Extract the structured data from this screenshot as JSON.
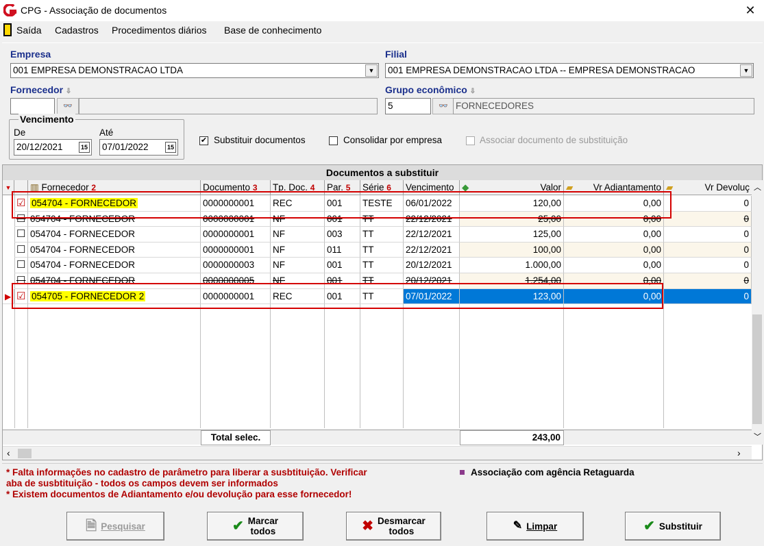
{
  "window": {
    "title": "CPG - Associação de documentos",
    "close_glyph": "✕"
  },
  "menu": {
    "items": [
      "Saída",
      "Cadastros",
      "Procedimentos diários",
      "Base de conhecimento"
    ]
  },
  "form": {
    "empresa_label": "Empresa",
    "empresa_value": "001 EMPRESA DEMONSTRACAO LTDA",
    "filial_label": "Filial",
    "filial_value": "001 EMPRESA DEMONSTRACAO LTDA -- EMPRESA DEMONSTRACAO",
    "fornecedor_label": "Fornecedor",
    "fornecedor_value": "",
    "fornecedor_name": "",
    "grupo_label": "Grupo econômico",
    "grupo_value": "5",
    "grupo_name": "FORNECEDORES",
    "vencimento_label": "Vencimento",
    "de_label": "De",
    "de_value": "20/12/2021",
    "ate_label": "Até",
    "ate_value": "07/01/2022",
    "date_btn": "15",
    "chk_substituir": "Substituir documentos",
    "chk_consolidar": "Consolidar por empresa",
    "chk_associar": "Associar documento de substituição"
  },
  "grid": {
    "caption": "Documentos a substituir",
    "headers": [
      {
        "label": "Fornecedor",
        "num": "2"
      },
      {
        "label": "Documento",
        "num": "3"
      },
      {
        "label": "Tp. Doc.",
        "num": "4"
      },
      {
        "label": "Par.",
        "num": "5"
      },
      {
        "label": "Série",
        "num": "6"
      },
      {
        "label": "Vencimento",
        "num": ""
      },
      {
        "label": "Valor",
        "num": ""
      },
      {
        "label": "Vr Adiantamento",
        "num": ""
      },
      {
        "label": "Vr Devoluç",
        "num": ""
      }
    ],
    "rows": [
      {
        "checked": "☑",
        "fornecedor": "054704 - FORNECEDOR",
        "documento": "0000000001",
        "tp": "REC",
        "par": "001",
        "serie": "TESTE",
        "venc": "06/01/2022",
        "valor": "120,00",
        "adiant": "0,00",
        "devol": "0"
      },
      {
        "checked": "☐",
        "fornecedor": "054704 - FORNECEDOR",
        "documento": "0000000001",
        "tp": "NF",
        "par": "001",
        "serie": "TT",
        "venc": "22/12/2021",
        "valor": "25,00",
        "adiant": "0,00",
        "devol": "0"
      },
      {
        "checked": "☐",
        "fornecedor": "054704 - FORNECEDOR",
        "documento": "0000000001",
        "tp": "NF",
        "par": "003",
        "serie": "TT",
        "venc": "22/12/2021",
        "valor": "125,00",
        "adiant": "0,00",
        "devol": "0"
      },
      {
        "checked": "☐",
        "fornecedor": "054704 - FORNECEDOR",
        "documento": "0000000001",
        "tp": "NF",
        "par": "011",
        "serie": "TT",
        "venc": "22/12/2021",
        "valor": "100,00",
        "adiant": "0,00",
        "devol": "0"
      },
      {
        "checked": "☐",
        "fornecedor": "054704 - FORNECEDOR",
        "documento": "0000000003",
        "tp": "NF",
        "par": "001",
        "serie": "TT",
        "venc": "20/12/2021",
        "valor": "1.000,00",
        "adiant": "0,00",
        "devol": "0"
      },
      {
        "checked": "☐",
        "fornecedor": "054704 - FORNECEDOR",
        "documento": "0000000005",
        "tp": "NF",
        "par": "001",
        "serie": "TT",
        "venc": "20/12/2021",
        "valor": "1.254,00",
        "adiant": "0,00",
        "devol": "0"
      },
      {
        "checked": "☑",
        "fornecedor": "054705 - FORNECEDOR 2",
        "documento": "0000000001",
        "tp": "REC",
        "par": "001",
        "serie": "TT",
        "venc": "07/01/2022",
        "valor": "123,00",
        "adiant": "0,00",
        "devol": "0"
      }
    ],
    "total_label": "Total selec.",
    "total_value": "243,00"
  },
  "notes": {
    "line1": "* Falta informações no cadastro de parâmetro para liberar a susbtituição. Verificar",
    "line2": "aba de susbtituição - todos os campos devem ser informados",
    "line3": "* Existem documentos de Adiantamento e/ou devolução para esse fornecedor!",
    "legend": "Associação com agência Retaguarda",
    "legend_color": "#8b3a8b"
  },
  "buttons": {
    "pesquisar": "Pesquisar",
    "marcar_1": "Marcar",
    "marcar_2": "todos",
    "desmarcar_1": "Desmarcar",
    "desmarcar_2": "todos",
    "limpar": "Limpar",
    "substituir": "Substituir"
  },
  "colors": {
    "accent_blue": "#1a2f8c",
    "selection": "#0078d7",
    "highlight": "#ffff00",
    "annotation_red": "#d40000"
  }
}
